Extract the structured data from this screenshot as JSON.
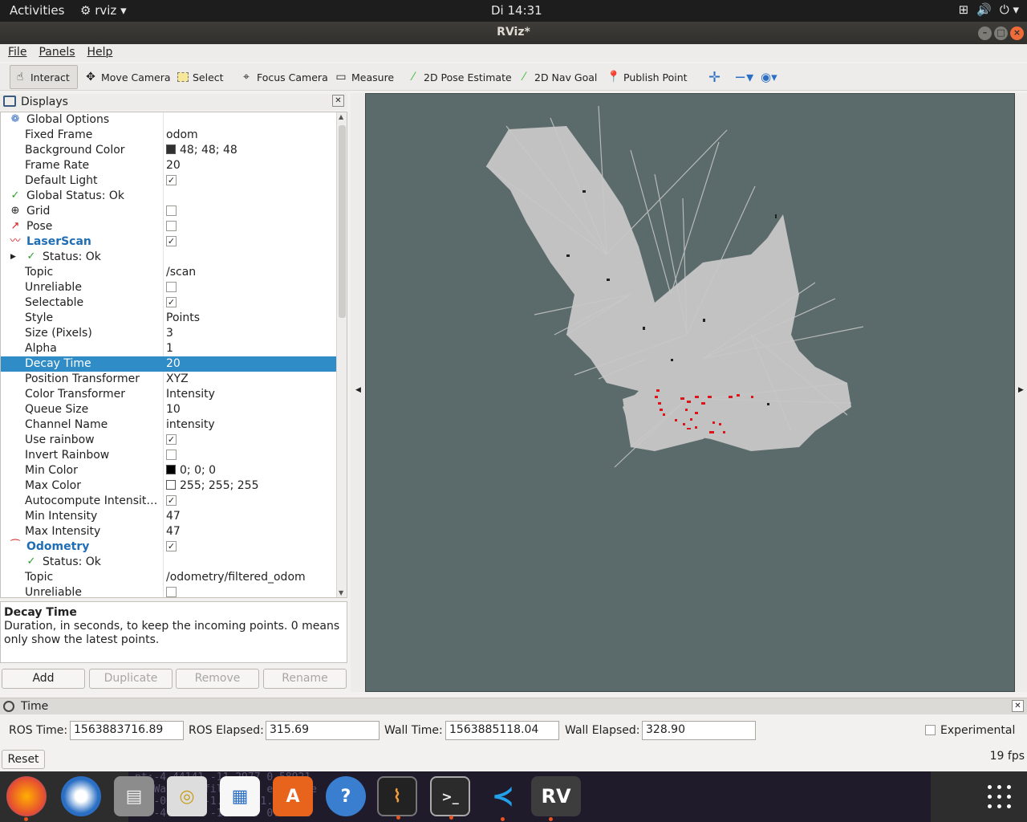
{
  "topbar": {
    "activities": "Activities",
    "app_name": "rviz",
    "clock": "Di 14:31"
  },
  "window": {
    "title": "RViz*"
  },
  "menu": {
    "file": "File",
    "panels": "Panels",
    "help": "Help"
  },
  "toolbar": {
    "interact": "Interact",
    "move_camera": "Move Camera",
    "select": "Select",
    "focus_camera": "Focus Camera",
    "measure": "Measure",
    "pose_estimate": "2D Pose Estimate",
    "nav_goal": "2D Nav Goal",
    "publish_point": "Publish Point"
  },
  "displays": {
    "title": "Displays",
    "rows": {
      "global_options": "Global Options",
      "fixed_frame_k": "Fixed Frame",
      "fixed_frame_v": "odom",
      "bg_color_k": "Background Color",
      "bg_color_v": "48; 48; 48",
      "frame_rate_k": "Frame Rate",
      "frame_rate_v": "20",
      "default_light_k": "Default Light",
      "global_status": "Global Status: Ok",
      "grid": "Grid",
      "pose": "Pose",
      "laserscan": "LaserScan",
      "ls_status": "Status: Ok",
      "topic_k": "Topic",
      "topic_v": "/scan",
      "unreliable_k": "Unreliable",
      "selectable_k": "Selectable",
      "style_k": "Style",
      "style_v": "Points",
      "size_k": "Size (Pixels)",
      "size_v": "3",
      "alpha_k": "Alpha",
      "alpha_v": "1",
      "decay_k": "Decay Time",
      "decay_v": "20",
      "pos_tf_k": "Position Transformer",
      "pos_tf_v": "XYZ",
      "col_tf_k": "Color Transformer",
      "col_tf_v": "Intensity",
      "queue_k": "Queue Size",
      "queue_v": "10",
      "channel_k": "Channel Name",
      "channel_v": "intensity",
      "rainbow_k": "Use rainbow",
      "invert_k": "Invert Rainbow",
      "min_color_k": "Min Color",
      "min_color_v": "0; 0; 0",
      "max_color_k": "Max Color",
      "max_color_v": "255; 255; 255",
      "autocompute_k": "Autocompute Intensit…",
      "min_int_k": "Min Intensity",
      "min_int_v": "47",
      "max_int_k": "Max Intensity",
      "max_int_v": "47",
      "odometry": "Odometry",
      "od_status": "Status: Ok",
      "od_topic_k": "Topic",
      "od_topic_v": "/odometry/filtered_odom",
      "od_unreliable_k": "Unreliable"
    },
    "desc_title": "Decay Time",
    "desc_text": "Duration, in seconds, to keep the incoming points. 0 means only show the latest points.",
    "buttons": {
      "add": "Add",
      "duplicate": "Duplicate",
      "remove": "Remove",
      "rename": "Rename"
    }
  },
  "time": {
    "title": "Time",
    "ros_time_label": "ROS Time:",
    "ros_time": "1563883716.89",
    "ros_elapsed_label": "ROS Elapsed:",
    "ros_elapsed": "315.69",
    "wall_time_label": "Wall Time:",
    "wall_time": "1563885118.04",
    "wall_elapsed_label": "Wall Elapsed:",
    "wall_elapsed": "328.90",
    "experimental": "Experimental",
    "reset": "Reset",
    "fps": "19 fps"
  },
  "colors": {
    "view_bg": "#5b6a6a",
    "selection": "#308cc6",
    "scan": "#d9161a",
    "map": "#c2c2c2"
  }
}
